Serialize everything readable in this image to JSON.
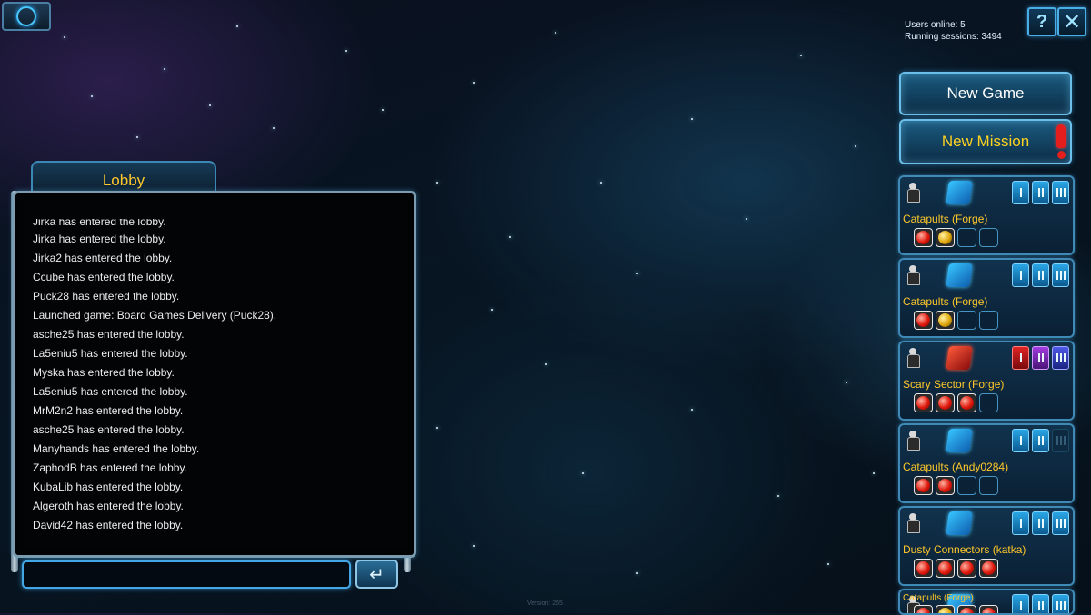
{
  "header": {
    "profile_icon": "robot-face-icon",
    "stats": {
      "users_online": "Users online: 5",
      "running_sessions": "Running sessions: 3494"
    },
    "help_label": "?",
    "close_label": "✕"
  },
  "actions": {
    "new_game": "New Game",
    "new_mission": "New Mission"
  },
  "sessions": [
    {
      "title": "Catapults (Forge)",
      "emblem": "blue",
      "tiers": [
        "blue",
        "blue",
        "blue"
      ],
      "balls": [
        "red",
        "gold",
        "empty",
        "empty"
      ]
    },
    {
      "title": "Catapults (Forge)",
      "emblem": "blue",
      "tiers": [
        "blue",
        "blue",
        "blue"
      ],
      "balls": [
        "red",
        "gold",
        "empty",
        "empty"
      ]
    },
    {
      "title": "Scary Sector (Forge)",
      "emblem": "red",
      "tiers": [
        "red",
        "purple",
        "indigo"
      ],
      "balls": [
        "red",
        "red",
        "red",
        "empty"
      ]
    },
    {
      "title": "Catapults (Andy0284)",
      "emblem": "blue",
      "tiers": [
        "blue",
        "blue",
        "dim"
      ],
      "balls": [
        "red",
        "red",
        "empty",
        "empty"
      ]
    },
    {
      "title": "Dusty Connectors (katka)",
      "emblem": "blue",
      "tiers": [
        "blue",
        "blue",
        "blue"
      ],
      "balls": [
        "red",
        "red",
        "red",
        "red"
      ]
    },
    {
      "title": "Catapults (Forge)",
      "emblem": "blue",
      "tiers": [
        "blue",
        "blue",
        "blue"
      ],
      "balls": [
        "red",
        "gold",
        "red",
        "red"
      ]
    }
  ],
  "lobby": {
    "tab_label": "Lobby",
    "messages": [
      "Jirka has entered the lobby.",
      "Jirka has entered the lobby.",
      "Jirka2 has entered the lobby.",
      "Ccube has entered the lobby.",
      "Puck28 has entered the lobby.",
      "Launched game: Board Games Delivery (Puck28).",
      "asche25 has entered the lobby.",
      "La5eniu5 has entered the lobby.",
      "Myska has entered the lobby.",
      "La5eniu5 has entered the lobby.",
      "MrM2n2 has entered the lobby.",
      "asche25 has entered the lobby.",
      "Manyhands has entered the lobby.",
      "ZaphodB has entered the lobby.",
      "KubaLib has entered the lobby.",
      "Algeroth has entered the lobby.",
      "David42 has entered the lobby."
    ],
    "input_value": "",
    "input_placeholder": "",
    "send_icon": "enter-return-icon"
  },
  "footer": {
    "version": "Version: 265"
  }
}
